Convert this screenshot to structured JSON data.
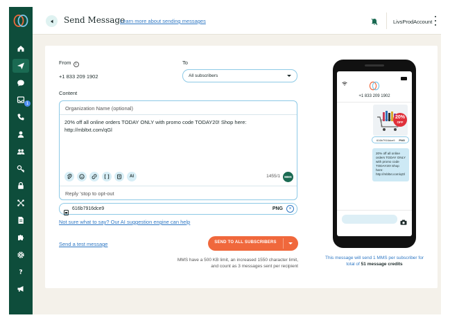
{
  "header": {
    "title": "Send Message",
    "learn_link": "Learn more about sending messages",
    "account": "LivsProdAccount"
  },
  "sidebar": {
    "items": [
      {
        "icon": "home-icon",
        "active": false
      },
      {
        "icon": "send-icon",
        "active": true
      },
      {
        "icon": "chat-icon",
        "active": false
      },
      {
        "icon": "inbox-icon",
        "active": false,
        "badge": "1"
      },
      {
        "icon": "phone-icon",
        "active": false
      },
      {
        "icon": "contact-icon",
        "active": false
      },
      {
        "icon": "group-icon",
        "active": false
      },
      {
        "icon": "key-icon",
        "active": false
      },
      {
        "icon": "lock-icon",
        "active": false
      },
      {
        "icon": "integrations-icon",
        "active": false
      },
      {
        "icon": "document-icon",
        "active": false
      },
      {
        "icon": "puzzle-icon",
        "active": false
      },
      {
        "icon": "settings-icon",
        "active": false
      },
      {
        "icon": "help-icon",
        "active": false
      },
      {
        "icon": "megaphone-icon",
        "active": false
      }
    ]
  },
  "form": {
    "from_label": "From",
    "from_value": "+1 833 209 1902",
    "to_label": "To",
    "to_value": "All subscribers",
    "content_label": "Content",
    "org_placeholder": "Organization Name (optional)",
    "message": "20% off all online orders TODAY ONLY with promo code TODAY20! Shop here: http://mbltxt.com/qGl",
    "ai_tool_label": "AI",
    "char_count": "1455/1",
    "mms_badge": "MMS",
    "optout_text": "Reply 'stop to opt-out",
    "file_name": "616b7916dce9",
    "file_type": "PNG",
    "file_remove": "×",
    "ai_suggestion_link": "Not sure what to say? Our AI suggestion engine can help",
    "test_link": "Send a test message",
    "send_button": "SEND TO ALL SUBSCRIBERS",
    "mms_note": "MMS have a 500 KB limit, an increased 1550 character limit, and count as 3 messages sent per recipient"
  },
  "preview": {
    "number": "+1 833 209 1902",
    "image_badge_line1": "20%",
    "image_badge_line2": "OFF",
    "file_name": "616b7916dce9",
    "file_type": "PNG",
    "bubble_text": "20% off all online orders TODAY ONLY with promo code TODAY20! Shop here: http://mbltxt.com/qGl",
    "note_prefix": "This message will send 1 MMS per subscriber for total of ",
    "note_credits": "51 message credits"
  },
  "colors": {
    "sidebar": "#0e4d3b",
    "accent_orange": "#f0683c",
    "link_blue": "#2f78c4",
    "input_border": "#8cc9e6"
  }
}
